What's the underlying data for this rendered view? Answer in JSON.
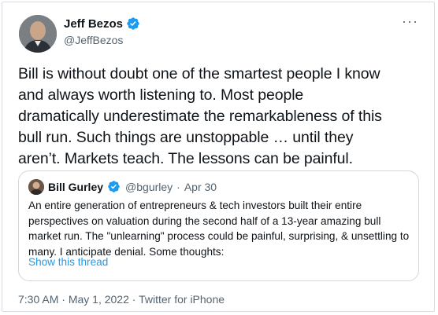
{
  "author": {
    "name": "Jeff Bezos",
    "handle": "@JeffBezos",
    "verified": true
  },
  "more_label": "···",
  "tweet": {
    "lines": [
      "Bill is without doubt one of the smartest people I know",
      "and always worth listening to. Most people",
      "dramatically underestimate the remarkableness of this",
      "bull run. Such things are unstoppable … until they",
      "aren’t.  Markets teach. The lessons can be painful."
    ]
  },
  "quote": {
    "name": "Bill Gurley",
    "handle": "@bgurley",
    "separator": "·",
    "date": "Apr 30",
    "lines": [
      "An entire generation of entrepreneurs & tech investors built their entire",
      "perspectives on valuation during the second  half of a 13-year amazing bull",
      "market run. The \"unlearning\" process could be painful, surprising, & unsettling to",
      "many. I anticipate denial. Some thoughts:"
    ],
    "show_thread": "Show this thread"
  },
  "footer": {
    "time": "7:30 AM",
    "separator": "·",
    "date": "May 1, 2022",
    "source": "Twitter for iPhone"
  },
  "colors": {
    "verified": "#1d9bf0",
    "link": "#1d9bf0",
    "secondary_text": "#536471"
  }
}
